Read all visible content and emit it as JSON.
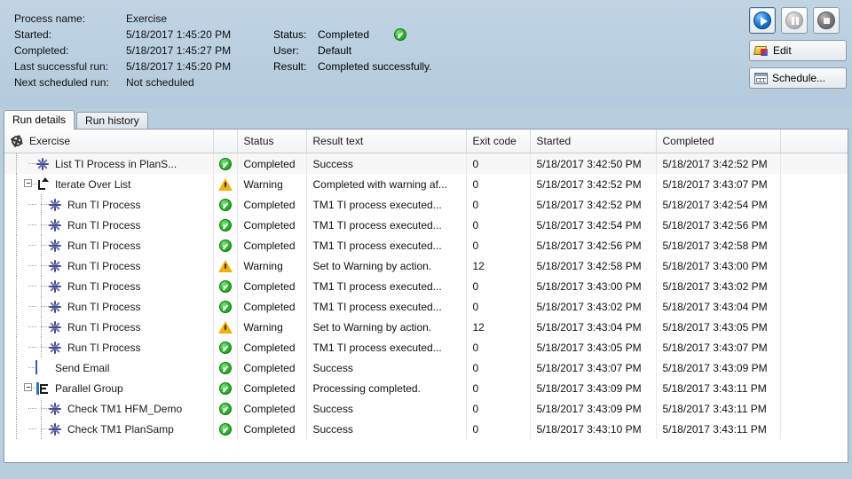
{
  "header": {
    "fields": [
      {
        "label": "Process name:",
        "value": "Exercise"
      },
      {
        "label": "Started:",
        "value": "5/18/2017 1:45:20 PM"
      },
      {
        "label": "Completed:",
        "value": "5/18/2017 1:45:27 PM"
      },
      {
        "label": "Last successful run:",
        "value": "5/18/2017 1:45:20 PM"
      },
      {
        "label": "Next scheduled run:",
        "value": "Not scheduled"
      }
    ],
    "fields2": [
      {
        "label": "Status:",
        "value": "Completed"
      },
      {
        "label": "User:",
        "value": "Default"
      },
      {
        "label": "Result:",
        "value": "Completed successfully."
      }
    ],
    "status_icon": "check-circle-icon"
  },
  "toolbar": {
    "play": {
      "name": "play-button",
      "icon": "play-icon"
    },
    "pause": {
      "name": "pause-button",
      "icon": "pause-icon"
    },
    "stop": {
      "name": "stop-button",
      "icon": "stop-icon"
    },
    "edit_label": "Edit",
    "schedule_label": "Schedule..."
  },
  "tabs": [
    {
      "label": "Run details",
      "active": true
    },
    {
      "label": "Run history",
      "active": false
    }
  ],
  "grid": {
    "columns": [
      {
        "key": "name",
        "label": "Exercise"
      },
      {
        "key": "icon",
        "label": ""
      },
      {
        "key": "status",
        "label": "Status"
      },
      {
        "key": "result",
        "label": "Result text"
      },
      {
        "key": "exit",
        "label": "Exit code"
      },
      {
        "key": "started",
        "label": "Started"
      },
      {
        "key": "completed",
        "label": "Completed"
      },
      {
        "key": "filler",
        "label": ""
      }
    ],
    "header_icon": "gear-icon",
    "rows": [
      {
        "name": "List TI Process in PlanS...",
        "icon": "ti-process-icon",
        "depth": 1,
        "twisty": "none",
        "status": "Completed",
        "state": "ok",
        "result": "Success",
        "exit": "0",
        "started": "5/18/2017 3:42:50 PM",
        "completed": "5/18/2017 3:42:52 PM"
      },
      {
        "name": "Iterate Over List",
        "icon": "loop-icon",
        "depth": 0,
        "twisty": "minus",
        "status": "Warning",
        "state": "warn",
        "result": "Completed with warning af...",
        "exit": "0",
        "started": "5/18/2017 3:42:52 PM",
        "completed": "5/18/2017 3:43:07 PM"
      },
      {
        "name": "Run TI Process",
        "icon": "ti-process-icon",
        "depth": 2,
        "twisty": "none",
        "status": "Completed",
        "state": "ok",
        "result": "TM1 TI process executed...",
        "exit": "0",
        "started": "5/18/2017 3:42:52 PM",
        "completed": "5/18/2017 3:42:54 PM"
      },
      {
        "name": "Run TI Process",
        "icon": "ti-process-icon",
        "depth": 2,
        "twisty": "none",
        "status": "Completed",
        "state": "ok",
        "result": "TM1 TI process executed...",
        "exit": "0",
        "started": "5/18/2017 3:42:54 PM",
        "completed": "5/18/2017 3:42:56 PM"
      },
      {
        "name": "Run TI Process",
        "icon": "ti-process-icon",
        "depth": 2,
        "twisty": "none",
        "status": "Completed",
        "state": "ok",
        "result": "TM1 TI process executed...",
        "exit": "0",
        "started": "5/18/2017 3:42:56 PM",
        "completed": "5/18/2017 3:42:58 PM"
      },
      {
        "name": "Run TI Process",
        "icon": "ti-process-icon",
        "depth": 2,
        "twisty": "none",
        "status": "Warning",
        "state": "warn",
        "result": "Set to Warning by action.",
        "exit": "12",
        "started": "5/18/2017 3:42:58 PM",
        "completed": "5/18/2017 3:43:00 PM"
      },
      {
        "name": "Run TI Process",
        "icon": "ti-process-icon",
        "depth": 2,
        "twisty": "none",
        "status": "Completed",
        "state": "ok",
        "result": "TM1 TI process executed...",
        "exit": "0",
        "started": "5/18/2017 3:43:00 PM",
        "completed": "5/18/2017 3:43:02 PM"
      },
      {
        "name": "Run TI Process",
        "icon": "ti-process-icon",
        "depth": 2,
        "twisty": "none",
        "status": "Completed",
        "state": "ok",
        "result": "TM1 TI process executed...",
        "exit": "0",
        "started": "5/18/2017 3:43:02 PM",
        "completed": "5/18/2017 3:43:04 PM"
      },
      {
        "name": "Run TI Process",
        "icon": "ti-process-icon",
        "depth": 2,
        "twisty": "none",
        "status": "Warning",
        "state": "warn",
        "result": "Set to Warning by action.",
        "exit": "12",
        "started": "5/18/2017 3:43:04 PM",
        "completed": "5/18/2017 3:43:05 PM"
      },
      {
        "name": "Run TI Process",
        "icon": "ti-process-icon",
        "depth": 2,
        "twisty": "none",
        "status": "Completed",
        "state": "ok",
        "result": "TM1 TI process executed...",
        "exit": "0",
        "started": "5/18/2017 3:43:05 PM",
        "completed": "5/18/2017 3:43:07 PM"
      },
      {
        "name": "Send Email",
        "icon": "mail-icon",
        "depth": 1,
        "twisty": "none",
        "status": "Completed",
        "state": "ok",
        "result": "Success",
        "exit": "0",
        "started": "5/18/2017 3:43:07 PM",
        "completed": "5/18/2017 3:43:09 PM"
      },
      {
        "name": "Parallel Group",
        "icon": "parallel-group-icon",
        "depth": 0,
        "twisty": "minus",
        "status": "Completed",
        "state": "ok",
        "result": "Processing completed.",
        "exit": "0",
        "started": "5/18/2017 3:43:09 PM",
        "completed": "5/18/2017 3:43:11 PM"
      },
      {
        "name": "Check TM1 HFM_Demo",
        "icon": "ti-process-icon",
        "depth": 2,
        "twisty": "none",
        "status": "Completed",
        "state": "ok",
        "result": "Success",
        "exit": "0",
        "started": "5/18/2017 3:43:09 PM",
        "completed": "5/18/2017 3:43:11 PM"
      },
      {
        "name": "Check TM1 PlanSamp",
        "icon": "ti-process-icon",
        "depth": 2,
        "twisty": "none",
        "status": "Completed",
        "state": "ok",
        "result": "Success",
        "exit": "0",
        "started": "5/18/2017 3:43:10 PM",
        "completed": "5/18/2017 3:43:11 PM"
      }
    ]
  },
  "colors": {
    "chrome": "#b8cde0",
    "ok": "#2aa82a",
    "warn": "#efb111",
    "accent": "#1f7fdb"
  }
}
